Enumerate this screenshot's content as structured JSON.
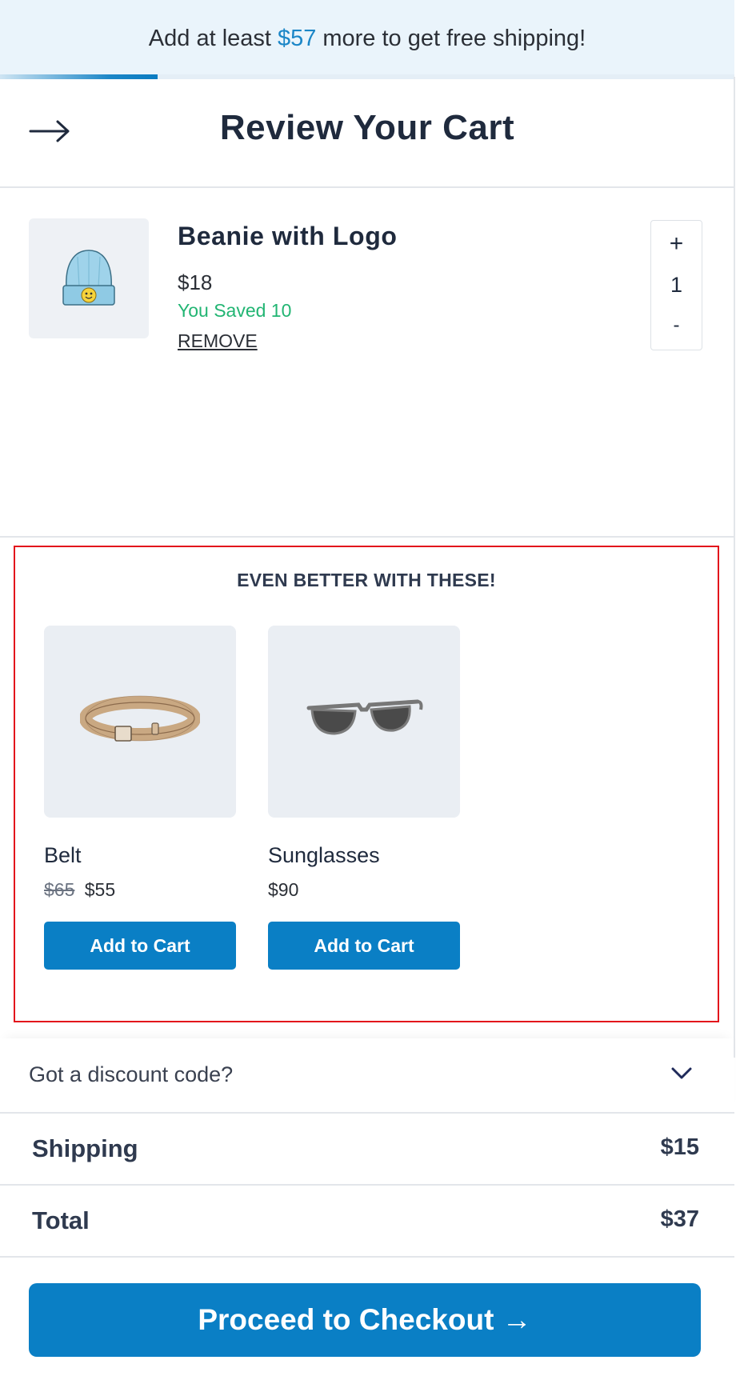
{
  "banner": {
    "prefix": "Add at least",
    "amount": "$57",
    "suffix": "more to get free shipping!",
    "progress": 0.215,
    "accent_color": "#1b86c7"
  },
  "header": {
    "title": "Review Your Cart",
    "back_icon": "arrow-right-icon"
  },
  "cart": {
    "items": [
      {
        "name": "Beanie with Logo",
        "price": "$18",
        "saved": "You Saved 10",
        "remove_label": "REMOVE",
        "quantity": "1",
        "plus": "+",
        "minus": "-",
        "image": "beanie-icon"
      }
    ]
  },
  "upsell": {
    "heading": "EVEN BETTER WITH THESE!",
    "products": [
      {
        "name": "Belt",
        "old_price": "$65",
        "price": "$55",
        "button": "Add to Cart",
        "image": "belt-icon"
      },
      {
        "name": "Sunglasses",
        "price": "$90",
        "button": "Add to Cart",
        "image": "sunglasses-icon"
      }
    ]
  },
  "discount": {
    "label": "Got a discount code?",
    "icon": "chevron-down-icon"
  },
  "summary": {
    "shipping_label": "Shipping",
    "shipping_value": "$15",
    "total_label": "Total",
    "total_value": "$37"
  },
  "checkout": {
    "label": "Proceed to Checkout →",
    "color": "#0a7fc5"
  },
  "colors": {
    "saved_green": "#22b573",
    "highlight_border": "#e3121b"
  }
}
